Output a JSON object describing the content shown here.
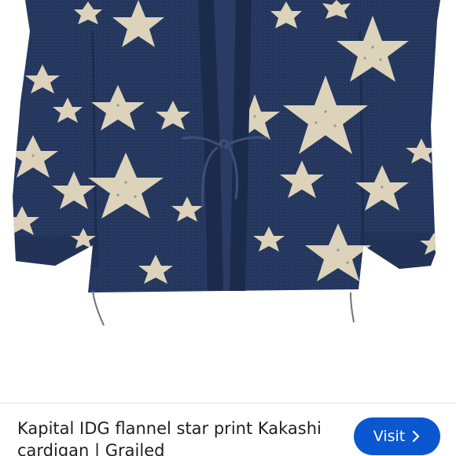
{
  "product_image": {
    "subject": "navy indigo flannel kimono-style cardigan with cream star print and drawstring tie",
    "colors": {
      "background": "#ffffff",
      "fabric": "#24365c",
      "fabric_dark": "#1a2848",
      "fabric_light": "#3a4d73",
      "star": "#e7dcc0",
      "star_dots": "#6a6f6a"
    }
  },
  "footer": {
    "title": "Kapital IDG flannel star print Kakashi cardigan | Grailed",
    "visit_label": "Visit",
    "visit_icon": "chevron-right-icon",
    "accent": "#0b57d0"
  }
}
